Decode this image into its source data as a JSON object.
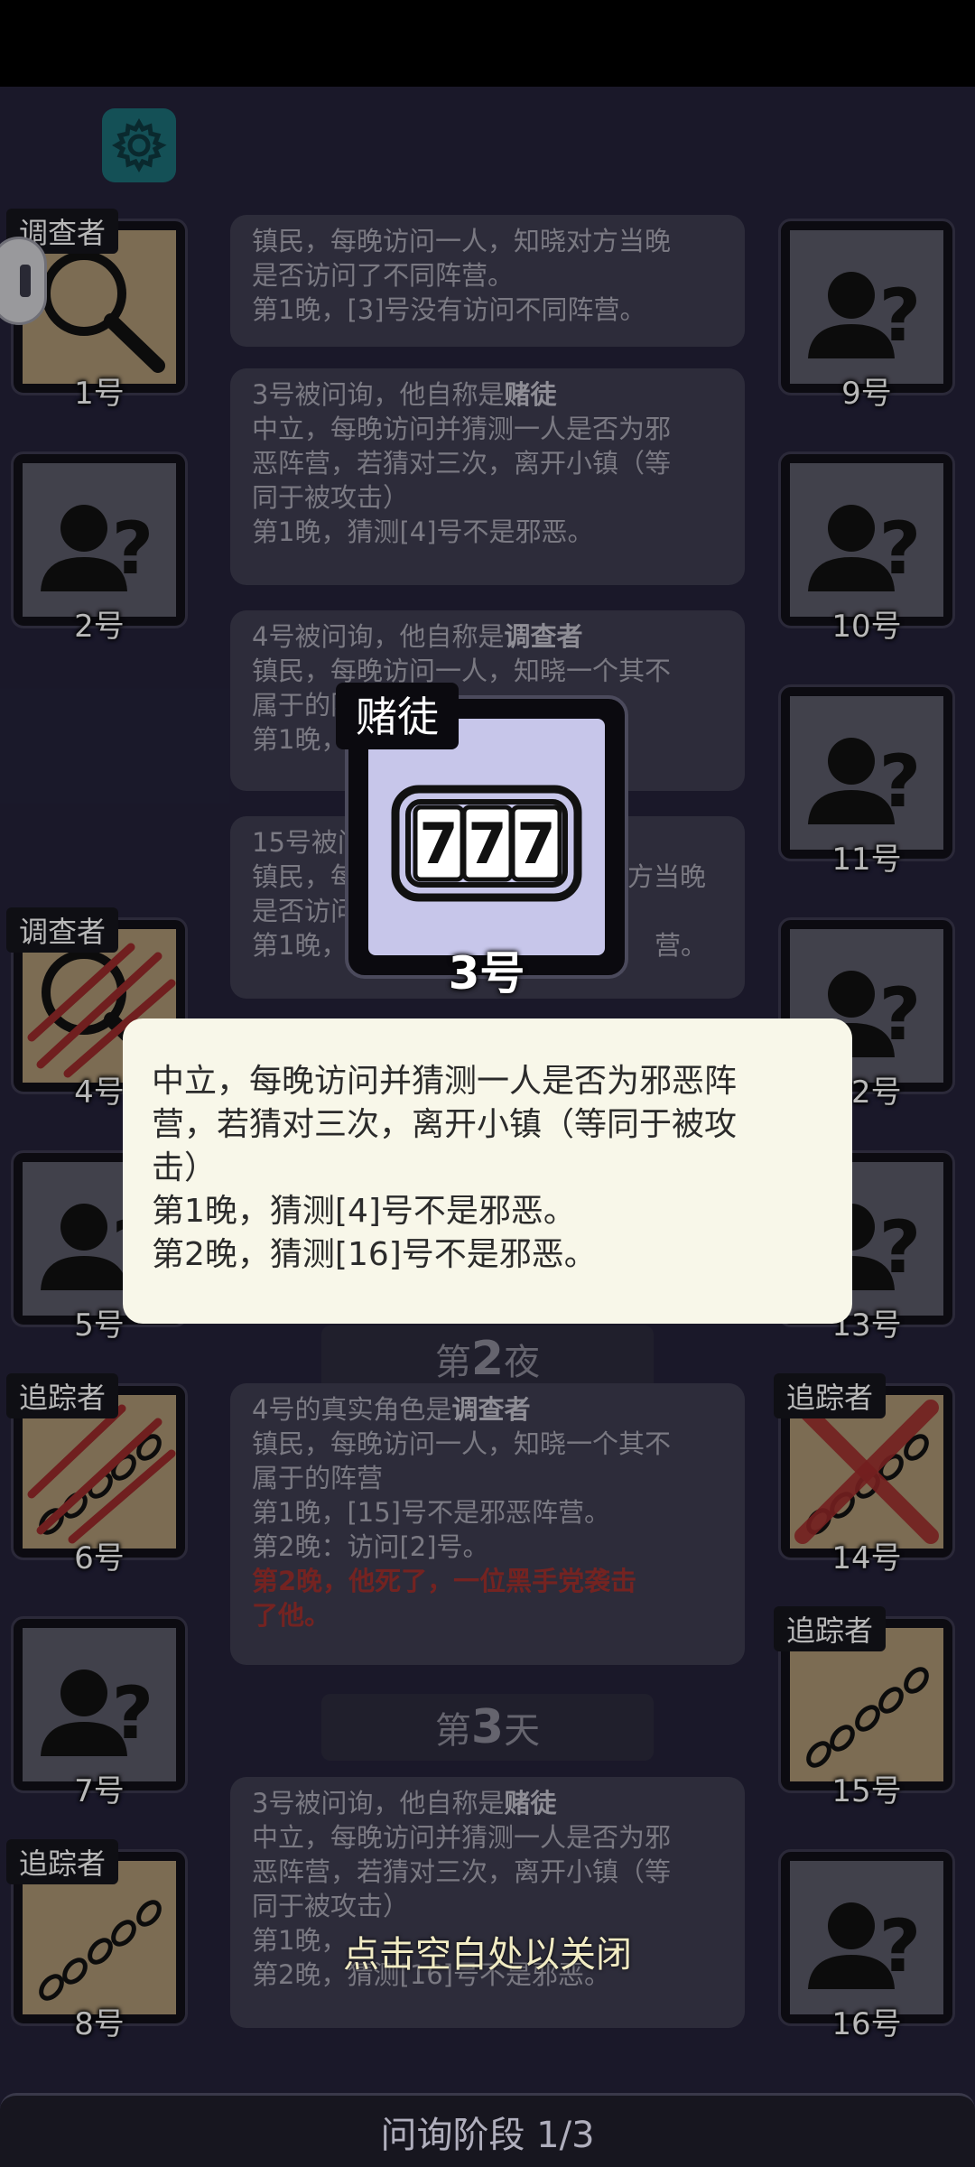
{
  "settings": {
    "icon": "gear-icon"
  },
  "players_left": [
    {
      "num": "1号",
      "role": "调查者",
      "icon": "magnifier-icon",
      "known": true
    },
    {
      "num": "2号",
      "role": "",
      "icon": "unknown-person-icon",
      "known": false
    },
    {
      "num": "4号",
      "role": "调查者",
      "icon": "magnifier-clawed-icon",
      "known": true
    },
    {
      "num": "5号",
      "role": "",
      "icon": "unknown-person-icon",
      "known": false
    },
    {
      "num": "6号",
      "role": "追踪者",
      "icon": "footprints-clawed-icon",
      "known": true
    },
    {
      "num": "7号",
      "role": "",
      "icon": "unknown-person-icon",
      "known": false
    },
    {
      "num": "8号",
      "role": "追踪者",
      "icon": "footprints-icon",
      "known": true
    }
  ],
  "players_right": [
    {
      "num": "9号",
      "role": "",
      "icon": "unknown-person-icon",
      "known": false
    },
    {
      "num": "10号",
      "role": "",
      "icon": "unknown-person-icon",
      "known": false
    },
    {
      "num": "11号",
      "role": "",
      "icon": "unknown-person-icon",
      "known": false
    },
    {
      "num": "12号",
      "role": "",
      "icon": "unknown-person-icon",
      "known": false
    },
    {
      "num": "13号",
      "role": "",
      "icon": "unknown-person-icon",
      "known": false
    },
    {
      "num": "14号",
      "role": "追踪者",
      "icon": "footprints-crossed-icon",
      "known": true
    },
    {
      "num": "15号",
      "role": "追踪者",
      "icon": "footprints-icon",
      "known": true
    },
    {
      "num": "16号",
      "role": "",
      "icon": "unknown-person-icon",
      "known": false
    }
  ],
  "log": {
    "entry1": {
      "line1": "镇民，每晚访问一人，知晓对方当晚",
      "line2": "是否访问了不同阵营。",
      "line3": "第1晚，[3]号没有访问不同阵营。"
    },
    "entry2": {
      "prefix": "3号被问询，他自称是",
      "claim": "赌徒",
      "line1": "中立，每晚访问并猜测一人是否为邪",
      "line2": "恶阵营，若猜对三次，离开小镇（等",
      "line3": "同于被攻击）",
      "line4": "第1晚，猜测[4]号不是邪恶。"
    },
    "entry3": {
      "prefix": "4号被问询，他自称是",
      "claim": "调查者",
      "line1": "镇民，每晚访问一人，知晓一个其不",
      "line2": "属于的阵营",
      "line3": "第1晚，"
    },
    "entry4": {
      "prefix": "15号被问",
      "line1": "镇民，每",
      "line1b": "方当晚",
      "line2": "是否访问",
      "line3": "第1晚，",
      "line3b": "营。"
    },
    "night2": {
      "pre": "第",
      "num": "2",
      "post": "夜"
    },
    "entry5": {
      "prefix": "4号的真实角色是",
      "claim": "调查者",
      "line1": "镇民，每晚访问一人，知晓一个其不",
      "line2": "属于的阵营",
      "line3": "第1晚，[15]号不是邪恶阵营。",
      "line4": "第2晚：访问[2]号。",
      "death1": "第2晚，他死了，一位黑手党袭击",
      "death2": "了他。"
    },
    "day3": {
      "pre": "第",
      "num": "3",
      "post": "天"
    },
    "entry6": {
      "prefix": "3号被问询，他自称是",
      "claim": "赌徒",
      "line1": "中立，每晚访问并猜测一人是否为邪",
      "line2": "恶阵营，若猜对三次，离开小镇（等",
      "line3": "同于被攻击）",
      "line4": "第1晚，",
      "line5": "第2晚，猜测[16]号不是邪恶。"
    }
  },
  "popup": {
    "role_name": "赌徒",
    "role_icon": "slot-machine-777-icon",
    "slot_symbols": [
      "7",
      "7",
      "7"
    ],
    "player_num": "3号",
    "desc_line1": "中立，每晚访问并猜测一人是否为邪恶阵",
    "desc_line2": "营，若猜对三次，离开小镇（等同于被攻",
    "desc_line3": "击）",
    "desc_line4": "第1晚，猜测[4]号不是邪恶。",
    "desc_line5": "第2晚，猜测[16]号不是邪恶。",
    "close_hint": "点击空白处以关闭"
  },
  "phase": {
    "label": "问询阶段 1/3"
  },
  "colors": {
    "background": "#24223a",
    "known_card": "#ac9674",
    "unknown_card": "#5b5a68",
    "popup_panel": "#f8f7e9",
    "danger_text": "#a1312f"
  }
}
